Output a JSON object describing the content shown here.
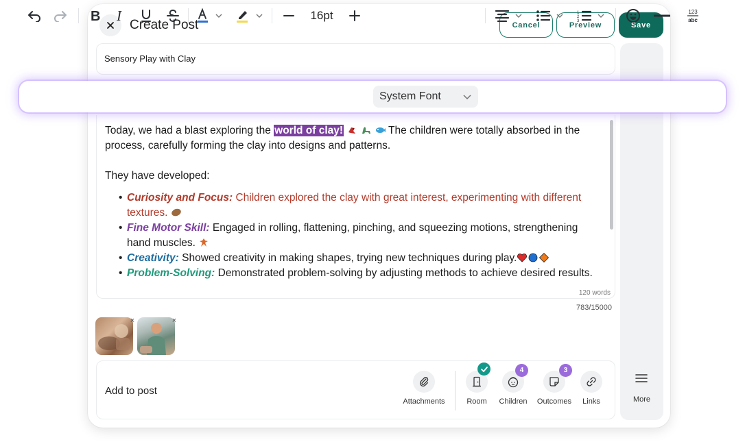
{
  "header": {
    "title": "Create Post",
    "cancel_label": "Cancel",
    "preview_label": "Preview",
    "save_label": "Save"
  },
  "post_title": {
    "value": "Sensory Play with Clay"
  },
  "toolbar": {
    "font_size": "16pt",
    "font_family": "System Font",
    "format_icons": [
      "undo-icon",
      "redo-icon",
      "bold-icon",
      "italic-icon",
      "underline-icon",
      "strikethrough-icon",
      "text-color-icon",
      "highlight-icon",
      "decrease-size-icon",
      "increase-size-icon",
      "align-center-icon",
      "bullet-list-icon",
      "numbered-list-icon",
      "emoji-icon",
      "horizontal-rule-icon",
      "text-case-icon"
    ],
    "text_color": "#2d6fd2",
    "highlight_color": "#f5d949",
    "case_glyph_top": "123",
    "case_glyph_bottom": "abc"
  },
  "editor": {
    "para1_before": "Today, we had a blast exploring the ",
    "para1_highlight": "world of clay!",
    "para1_after": " The children were totally absorbed in the process, carefully forming the clay into designs and patterns.",
    "para2": "They have developed:",
    "bullets": [
      {
        "label": "Curiosity and Focus:",
        "text": " Children explored the clay with great interest, experimenting with different textures. ",
        "color": "#b23a2a"
      },
      {
        "label": "Fine Motor Skill:",
        "text": " Engaged in rolling, flattening, pinching, and squeezing motions, strengthening hand muscles. ",
        "color": "#7b3fa0"
      },
      {
        "label": "Creativity:",
        "text": " Showed creativity in making shapes, trying new techniques during play.",
        "color": "#1d6d9e"
      },
      {
        "label": "Problem-Solving:",
        "text": " Demonstrated problem-solving by adjusting methods to achieve desired results.",
        "color": "#1f9a7a"
      }
    ],
    "highlight_color": "#7b3fa0",
    "word_count": "120 words",
    "char_count": "783/15000"
  },
  "attachments_preview": {
    "remove_glyph": "×"
  },
  "add_to_post": {
    "label": "Add to post",
    "actions": [
      {
        "label": "Attachments",
        "icon": "paperclip-icon"
      },
      {
        "label": "Room",
        "icon": "door-icon"
      },
      {
        "label": "Children",
        "icon": "child-face-icon",
        "badge": "4"
      },
      {
        "label": "Outcomes",
        "icon": "note-icon",
        "badge": "3"
      },
      {
        "label": "Links",
        "icon": "link-icon"
      }
    ]
  },
  "rail": {
    "more_label": "More",
    "more_icon": "hamburger-menu-icon"
  },
  "colors": {
    "brand": "#0e6a5a",
    "badge": "#9b6bdc",
    "check": "#13998a"
  }
}
